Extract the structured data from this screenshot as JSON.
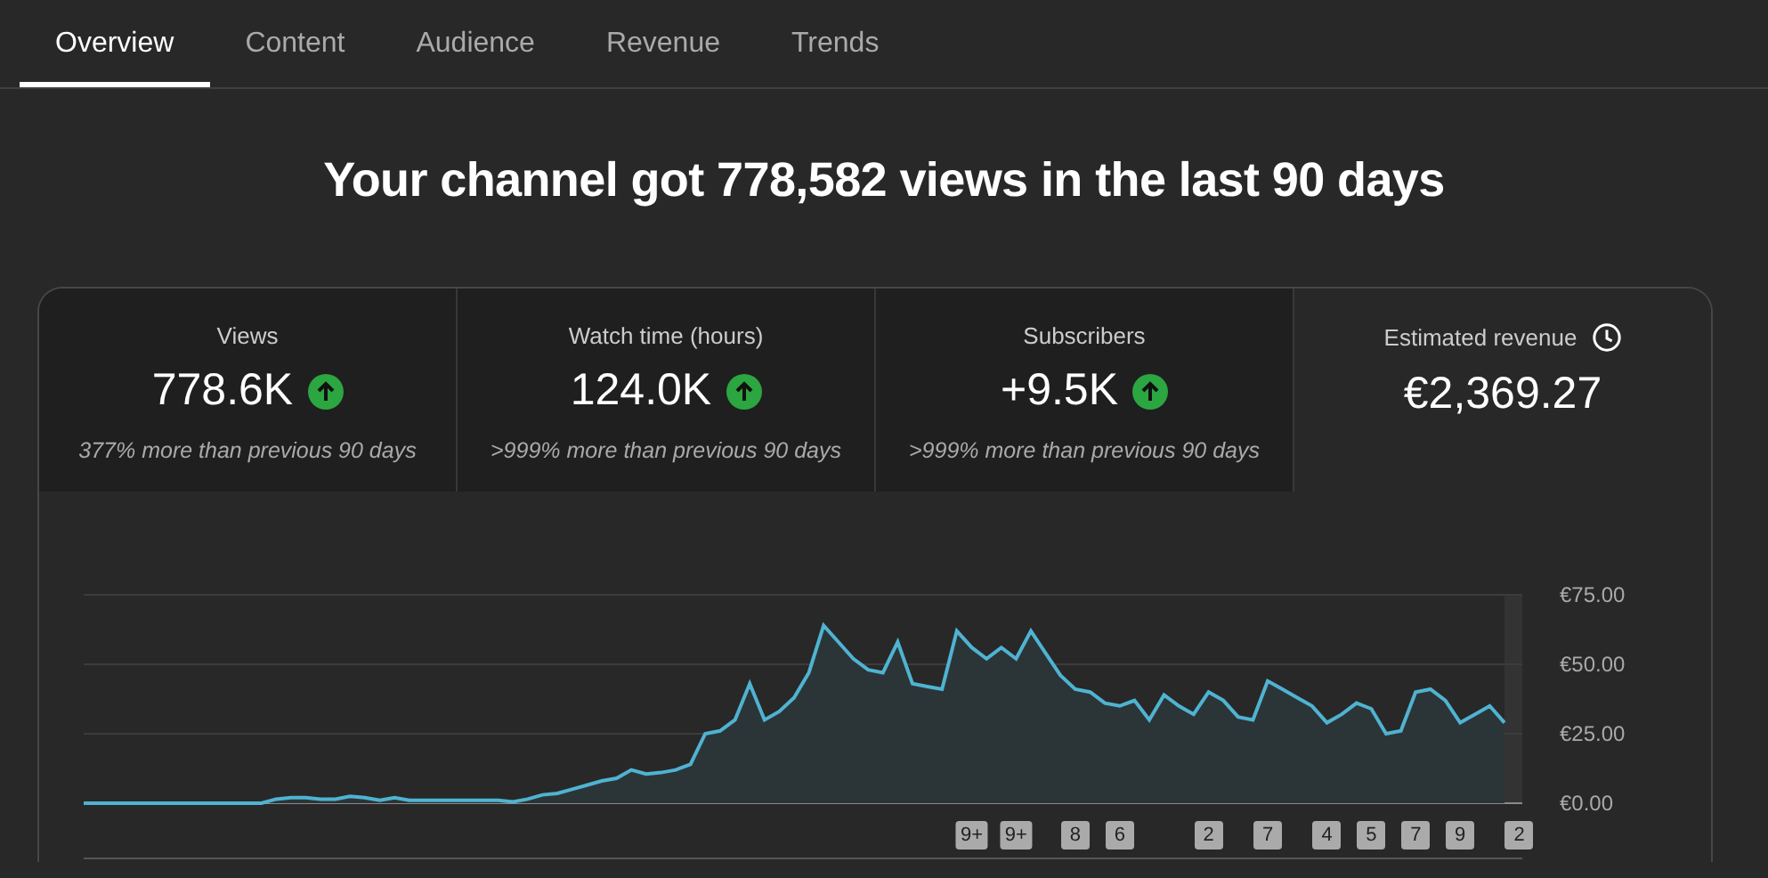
{
  "tabs": [
    {
      "label": "Overview",
      "selected": true
    },
    {
      "label": "Content",
      "selected": false
    },
    {
      "label": "Audience",
      "selected": false
    },
    {
      "label": "Revenue",
      "selected": false
    },
    {
      "label": "Trends",
      "selected": false
    }
  ],
  "headline": "Your channel got 778,582 views in the last 90 days",
  "metrics": [
    {
      "label": "Views",
      "value": "778.6K",
      "kind": "trend-up",
      "comparison": "377% more than previous 90 days",
      "selected": false
    },
    {
      "label": "Watch time (hours)",
      "value": "124.0K",
      "kind": "trend-up",
      "comparison": ">999% more than previous 90 days",
      "selected": false
    },
    {
      "label": "Subscribers",
      "value": "+9.5K",
      "kind": "trend-up",
      "comparison": ">999% more than previous 90 days",
      "selected": false
    },
    {
      "label": "Estimated revenue",
      "value": "€2,369.27",
      "kind": "info",
      "selected": true
    }
  ],
  "chart_data": {
    "type": "area",
    "ylim": [
      0,
      75
    ],
    "yticks": [
      {
        "value": 0,
        "label": "€0.00"
      },
      {
        "value": 25,
        "label": "€25.00"
      },
      {
        "value": 50,
        "label": "€50.00"
      },
      {
        "value": 75,
        "label": "€75.00"
      }
    ],
    "series": [
      {
        "color": "#4fb3d1",
        "values": [
          0,
          0,
          0,
          0,
          0,
          0,
          0,
          0,
          0,
          0,
          0,
          0,
          0,
          1.5,
          2,
          2,
          1.5,
          1.5,
          2.5,
          2,
          1,
          2,
          1,
          1,
          1,
          1,
          1,
          1,
          1,
          0.5,
          1.5,
          3,
          3.5,
          5,
          6.5,
          8,
          9,
          12,
          10.5,
          11,
          12,
          14,
          25,
          26,
          30,
          43,
          30,
          33,
          38,
          47,
          64,
          58,
          52,
          48,
          47,
          58,
          43,
          42,
          41,
          62,
          56,
          52,
          56,
          52,
          62,
          54,
          46,
          41,
          40,
          36,
          35,
          37,
          30,
          39,
          35,
          32,
          40,
          37,
          31,
          30,
          44,
          41,
          38,
          35,
          29,
          32,
          36,
          34,
          25,
          26,
          40,
          41,
          37,
          29,
          32,
          35,
          29
        ]
      }
    ]
  },
  "markers": [
    {
      "label": "9+"
    },
    {
      "label": "9+"
    },
    {
      "label": "8"
    },
    {
      "label": "6"
    },
    {
      "label": "2"
    },
    {
      "label": "7"
    },
    {
      "label": "4"
    },
    {
      "label": "5"
    },
    {
      "label": "7"
    },
    {
      "label": "9"
    },
    {
      "label": "2"
    }
  ]
}
